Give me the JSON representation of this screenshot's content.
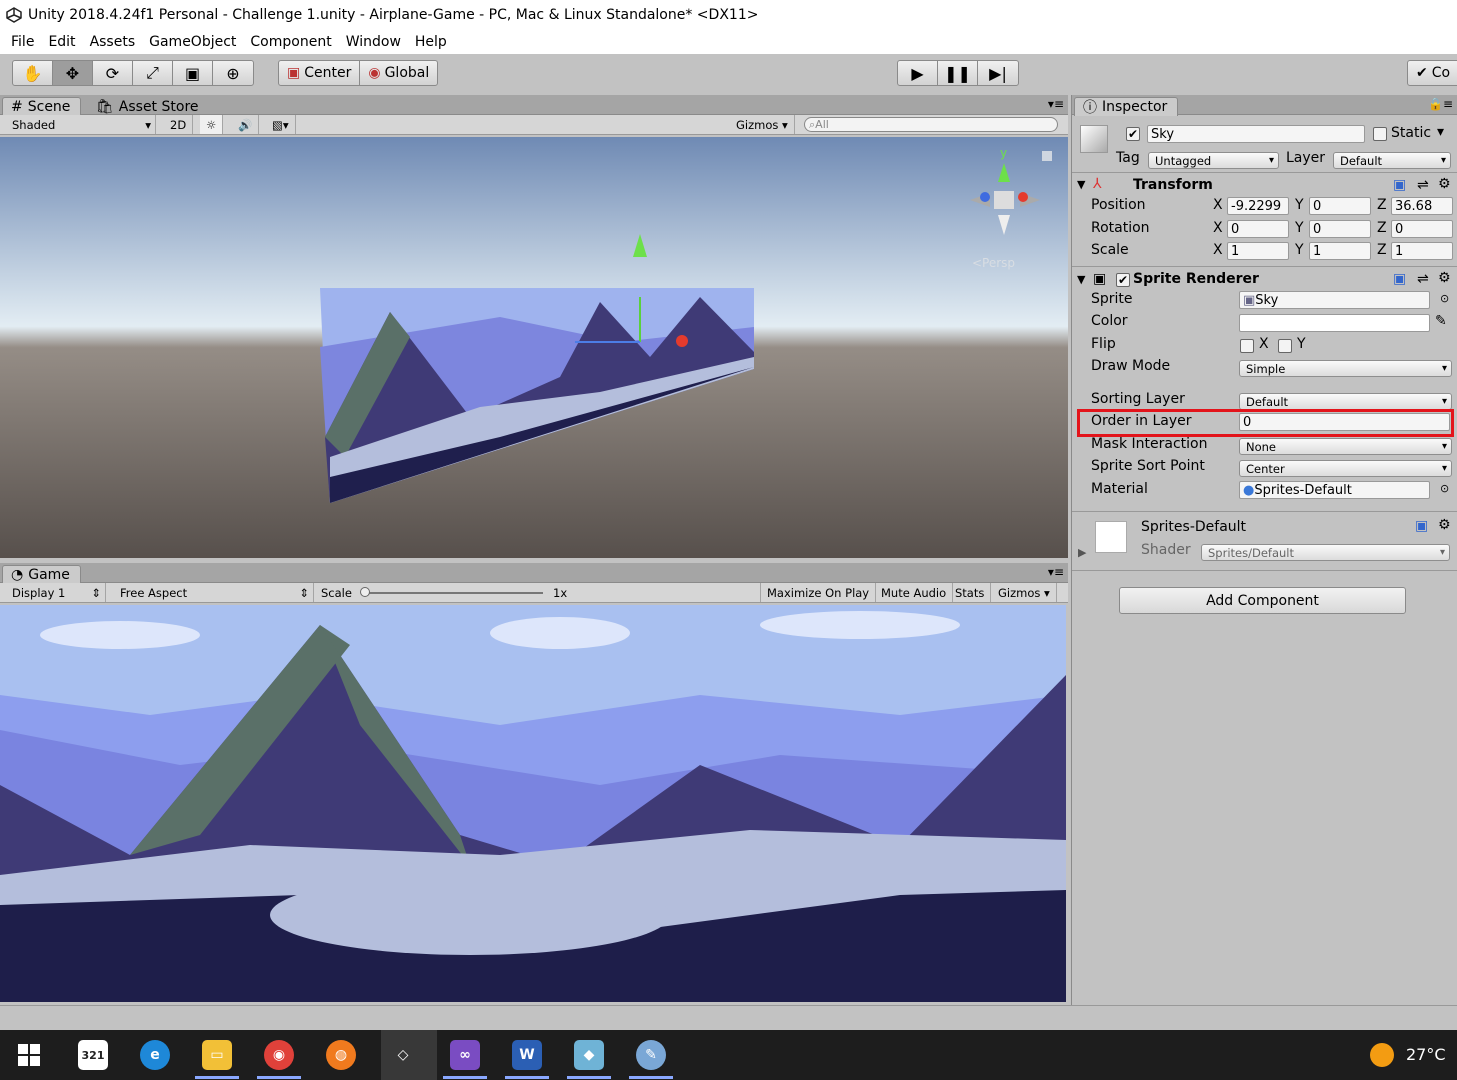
{
  "window": {
    "title": "Unity 2018.4.24f1 Personal - Challenge 1.unity - Airplane-Game - PC, Mac & Linux Standalone* <DX11>"
  },
  "menu": [
    "File",
    "Edit",
    "Assets",
    "GameObject",
    "Component",
    "Window",
    "Help"
  ],
  "toolbar": {
    "pivot_label": "Center",
    "space_label": "Global",
    "collab_label": "Co"
  },
  "scene": {
    "tab_scene": "Scene",
    "tab_store": "Asset Store",
    "shading": "Shaded",
    "mode2d": "2D",
    "gizmos": "Gizmos",
    "search_placeholder": "All",
    "persp": "<Persp",
    "gizmo_y": "y"
  },
  "game": {
    "tab": "Game",
    "display": "Display 1",
    "aspect": "Free Aspect",
    "scale_label": "Scale",
    "scale_value": "1x",
    "maximize": "Maximize On Play",
    "mute": "Mute Audio",
    "stats": "Stats",
    "gizmos": "Gizmos"
  },
  "inspector": {
    "tab": "Inspector",
    "object_name": "Sky",
    "static_label": "Static",
    "tag_label": "Tag",
    "tag_value": "Untagged",
    "layer_label": "Layer",
    "layer_value": "Default",
    "transform": {
      "title": "Transform",
      "position_label": "Position",
      "pos_x": "-9.2299",
      "pos_y": "0",
      "pos_z": "36.68",
      "rotation_label": "Rotation",
      "rot_x": "0",
      "rot_y": "0",
      "rot_z": "0",
      "scale_label": "Scale",
      "scale_x": "1",
      "scale_y": "1",
      "scale_z": "1",
      "x": "X",
      "y": "Y",
      "z": "Z"
    },
    "sprite_renderer": {
      "title": "Sprite Renderer",
      "sprite_label": "Sprite",
      "sprite_value": "Sky",
      "color_label": "Color",
      "flip_label": "Flip",
      "flip_x": "X",
      "flip_y": "Y",
      "draw_mode_label": "Draw Mode",
      "draw_mode_value": "Simple",
      "sorting_layer_label": "Sorting Layer",
      "sorting_layer_value": "Default",
      "order_label": "Order in Layer",
      "order_value": "0",
      "mask_label": "Mask Interaction",
      "mask_value": "None",
      "sort_point_label": "Sprite Sort Point",
      "sort_point_value": "Center",
      "material_label": "Material",
      "material_value": "Sprites-Default"
    },
    "material": {
      "name": "Sprites-Default",
      "shader_label": "Shader",
      "shader_value": "Sprites/Default"
    },
    "add_component": "Add Component"
  },
  "taskbar": {
    "temperature": "27°C",
    "calendar_icon_text": "321"
  },
  "colors": {
    "highlight": "#e3141b",
    "sky": "#a9c0f0",
    "mountain_dark": "#3f3a76",
    "ridge": "#5a7068",
    "forest": "#1e1e4a"
  }
}
